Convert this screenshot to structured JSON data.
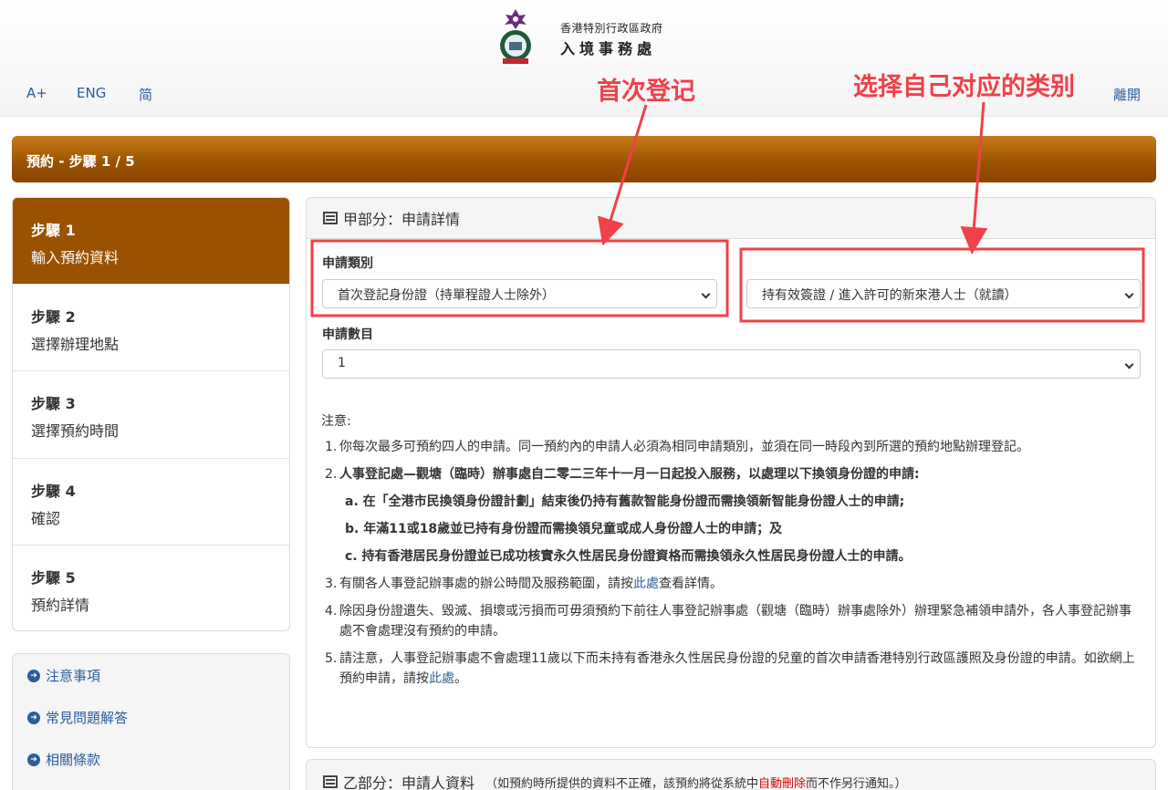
{
  "header": {
    "logo_line1": "香港特別行政區政府",
    "logo_line2": "入境事務處",
    "lang_links": [
      "A+",
      "ENG",
      "简"
    ],
    "exit": "離開"
  },
  "annotations": {
    "left": "首次登记",
    "right": "选择自己对应的类别",
    "color": "#f0414a"
  },
  "banner": {
    "title": "預約 - 步驟 1 / 5",
    "color": "#9a5100"
  },
  "steps": [
    {
      "num": "步驟 1",
      "label": "輸入預約資料",
      "active": true
    },
    {
      "num": "步驟 2",
      "label": "選擇辦理地點"
    },
    {
      "num": "步驟 3",
      "label": "選擇預約時間"
    },
    {
      "num": "步驟 4",
      "label": "確認"
    },
    {
      "num": "步驟 5",
      "label": "預約詳情"
    }
  ],
  "side_links": [
    "注意事項",
    "常見問題解答",
    "相關條款"
  ],
  "section_a": {
    "title": "甲部分：申請詳情",
    "category_label": "申請類別",
    "category_value": "首次登記身份證（持單程證人士除外）",
    "subcategory_value": "持有效簽證 / 進入許可的新來港人士（就讀）",
    "count_label": "申請數目",
    "count_value": "1"
  },
  "notes": {
    "title": "注意:",
    "n1": "你每次最多可預約四人的申請。同一預約內的申請人必須為相同申請類別，並須在同一時段內到所選的預約地點辦理登記。",
    "n2": "人事登記處—觀塘（臨時）辦事處自二零二三年十一月一日起投入服務，以處理以下換領身份證的申請:",
    "n2a": "a. 在「全港市民換領身份證計劃」結束後仍持有舊款智能身份證而需換領新智能身份證人士的申請;",
    "n2b": "b. 年滿11或18歲並已持有身份證而需換領兒童或成人身份證人士的申請；及",
    "n2c": "c. 持有香港居民身份證並已成功核實永久性居民身份證資格而需換領永久性居民身份證人士的申請。",
    "n3_pre": "有關各人事登記辦事處的辦公時間及服務範圍，請按",
    "n3_link": "此處",
    "n3_post": "查看詳情。",
    "n4": "除因身份證遺失、毀滅、損壞或污損而可毋須預約下前往人事登記辦事處（觀塘（臨時）辦事處除外）辦理緊急補領申請外，各人事登記辦事處不會處理沒有預約的申請。",
    "n5_pre": "請注意，人事登記辦事處不會處理11歲以下而未持有香港永久性居民身份證的兒童的首次申請香港特別行政區護照及身份證的申請。如欲網上預約申請，請按",
    "n5_link": "此處",
    "n5_post": "。"
  },
  "section_b": {
    "title": "乙部分：申請人資料",
    "note_pre": "（如預約時所提供的資料不正確，該預約將從系統中",
    "note_red": "自動刪除",
    "note_post": "而不作另行通知。）"
  }
}
